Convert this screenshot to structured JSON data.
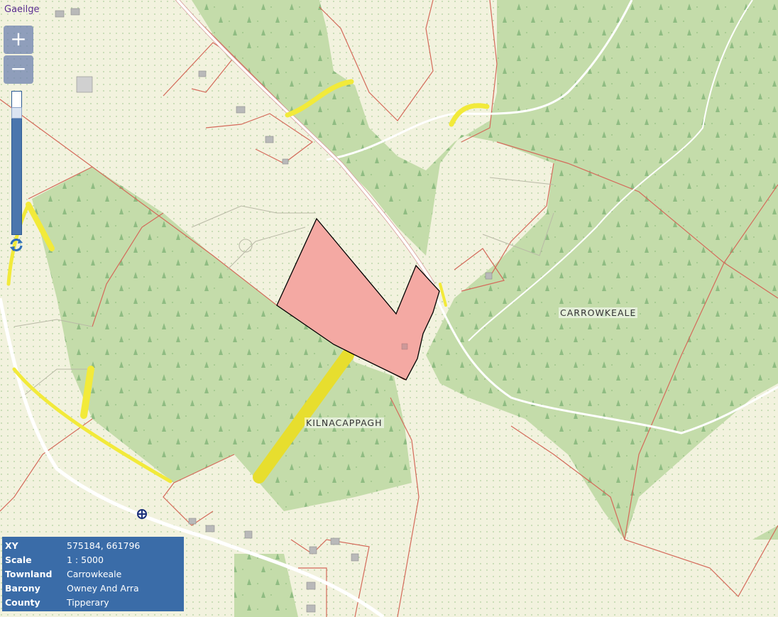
{
  "language_link": "Gaeilge",
  "zoom": {
    "in_label": "+",
    "out_label": "−",
    "level_fraction": 0.88
  },
  "labels": {
    "townland_1": "CARROWKEALE",
    "townland_2": "KILNACAPPAGH"
  },
  "info": {
    "rows": [
      {
        "key": "XY",
        "value": "575184, 661796"
      },
      {
        "key": "Scale",
        "value": "1 : 5000"
      },
      {
        "key": "Townland",
        "value": "Carrowkeale"
      },
      {
        "key": "Barony",
        "value": "Owney And Arra"
      },
      {
        "key": "County",
        "value": "Tipperary"
      }
    ]
  },
  "colors": {
    "background": "#f2f2de",
    "forest": "#c4dcaa",
    "boundary": "#d46a5a",
    "road_yellow": "#f2ea3a",
    "parcel_fill": "#f4a9a3",
    "panel": "#3a6ca8"
  },
  "icons": [
    "zoom-in-icon",
    "zoom-out-icon",
    "refresh-icon",
    "crosshair-icon"
  ]
}
